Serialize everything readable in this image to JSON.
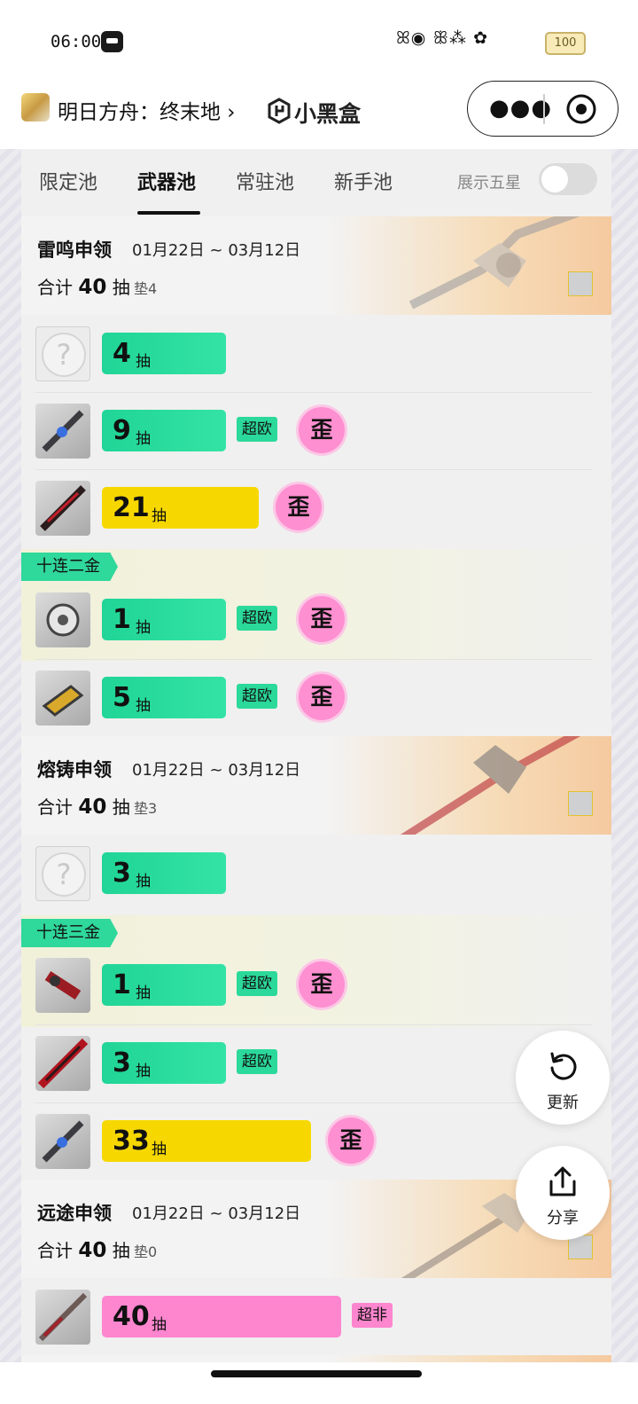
{
  "status_bar": {
    "time": "06:00",
    "icons": "ꕤ◉ ꕥ⁂ ✿",
    "battery": "100"
  },
  "nav": {
    "app_title": "明日方舟：终末地 ›",
    "brand": "小黑盒"
  },
  "tabs": [
    {
      "label": "限定池"
    },
    {
      "label": "武器池"
    },
    {
      "label": "常驻池"
    },
    {
      "label": "新手池"
    }
  ],
  "toggle": {
    "label": "展示五星",
    "on": false
  },
  "pools": [
    {
      "name": "雷鸣申领",
      "date": "01月22日 ~ 03月12日",
      "total_prefix": "合计",
      "total": "40",
      "total_unit": "抽",
      "pad": "垫4"
    },
    {
      "name": "熔铸申领",
      "date": "01月22日 ~ 03月12日",
      "total_prefix": "合计",
      "total": "40",
      "total_unit": "抽",
      "pad": "垫3"
    },
    {
      "name": "远途申领",
      "date": "01月22日 ~ 03月12日",
      "total_prefix": "合计",
      "total": "40",
      "total_unit": "抽",
      "pad": "垫0"
    }
  ],
  "rows": [
    {
      "count": "4",
      "unit": "抽",
      "tag": "",
      "wai": ""
    },
    {
      "count": "9",
      "unit": "抽",
      "tag": "超欧",
      "wai": "歪"
    },
    {
      "count": "21",
      "unit": "抽",
      "tag": "",
      "wai": "歪"
    },
    {
      "count": "1",
      "unit": "抽",
      "tag": "超欧",
      "wai": "歪"
    },
    {
      "count": "5",
      "unit": "抽",
      "tag": "超欧",
      "wai": "歪"
    },
    {
      "count": "3",
      "unit": "抽",
      "tag": "",
      "wai": ""
    },
    {
      "count": "1",
      "unit": "抽",
      "tag": "超欧",
      "wai": "歪"
    },
    {
      "count": "3",
      "unit": "抽",
      "tag": "超欧",
      "wai": ""
    },
    {
      "count": "33",
      "unit": "抽",
      "tag": "",
      "wai": "歪"
    },
    {
      "count": "40",
      "unit": "抽",
      "tag": "超非",
      "wai": ""
    }
  ],
  "ten_labels": [
    "十连二金",
    "十连三金"
  ],
  "buttons": {
    "refresh": "更新",
    "share": "分享"
  },
  "colors": {
    "green": "#2bd99a",
    "yellow": "#f6d800",
    "pink": "#fe86cf",
    "wai_badge": "#fe8fd1"
  }
}
